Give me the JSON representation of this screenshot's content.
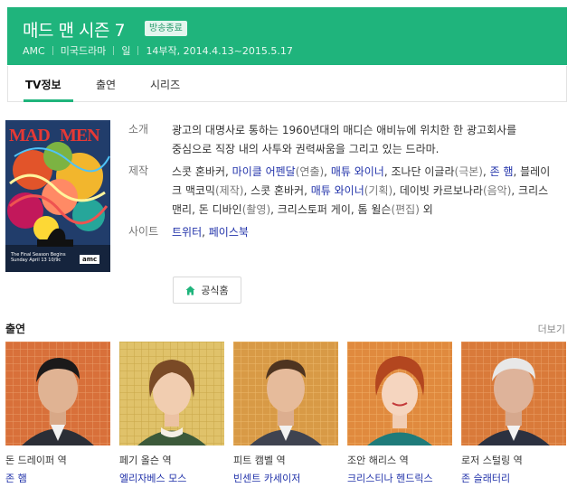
{
  "header": {
    "title": "매드 맨 시즌 7",
    "badge": "방송종료",
    "meta": [
      "AMC",
      "미국드라마",
      "일",
      "14부작, 2014.4.13~2015.5.17"
    ],
    "bg_color": "#1fb47c"
  },
  "tabs": [
    {
      "label": "TV정보",
      "active": true
    },
    {
      "label": "출연",
      "active": false
    },
    {
      "label": "시리즈",
      "active": false
    }
  ],
  "poster": {
    "logo_left": "MAD",
    "logo_right": "MEN",
    "caption_line1": "The Final Season Begins",
    "caption_line2": "Sunday April 13 10/9c",
    "network": "amc"
  },
  "info": {
    "summary_label": "소개",
    "summary_line1": "광고의 대명사로 통하는 1960년대의 매디슨 애비뉴에 위치한 한 광고회사를",
    "summary_line2": "중심으로 직장 내의 사투와 권력싸움을 그리고 있는 드라마.",
    "production_label": "제작",
    "production": {
      "p1": "스콧 혼바커, ",
      "l1": "마이클 어펜달",
      "r1": "(연출)",
      "p2": ", ",
      "l2": "매튜 와이너",
      "p3": ", 조나단 이글라",
      "r2": "(극본)",
      "p4": ", ",
      "l3": "존 햄",
      "p5": ", 블레이크 맥코믹",
      "r3": "(제작)",
      "p6": ", 스콧 혼바커, ",
      "l4": "매튜 와이너",
      "r4": "(기획)",
      "p7": ", 데이빗 카르보나라",
      "r5": "(음악)",
      "p8": ", 크리스 맨리, 돈 디바인",
      "r6": "(촬영)",
      "p9": ", 크리스토퍼 게이, 톰 윌슨",
      "r7": "(편집)",
      "p10": " 외"
    },
    "site_label": "사이트",
    "site_links": [
      "트위터",
      "페이스북"
    ],
    "site_sep": ", "
  },
  "home_button": {
    "label": "공식홈",
    "icon": "home-icon"
  },
  "cast": {
    "title": "출연",
    "more": "더보기",
    "members": [
      {
        "role": "돈 드레이퍼 역",
        "actor": "존 햄"
      },
      {
        "role": "페기 올슨 역",
        "actor": "엘리자베스 모스"
      },
      {
        "role": "피트 캠벨 역",
        "actor": "빈센트 카세이저"
      },
      {
        "role": "조안 해리스 역",
        "actor": "크리스티나 헨드릭스"
      },
      {
        "role": "로저 스털링 역",
        "actor": "존 슬래터리"
      }
    ]
  }
}
